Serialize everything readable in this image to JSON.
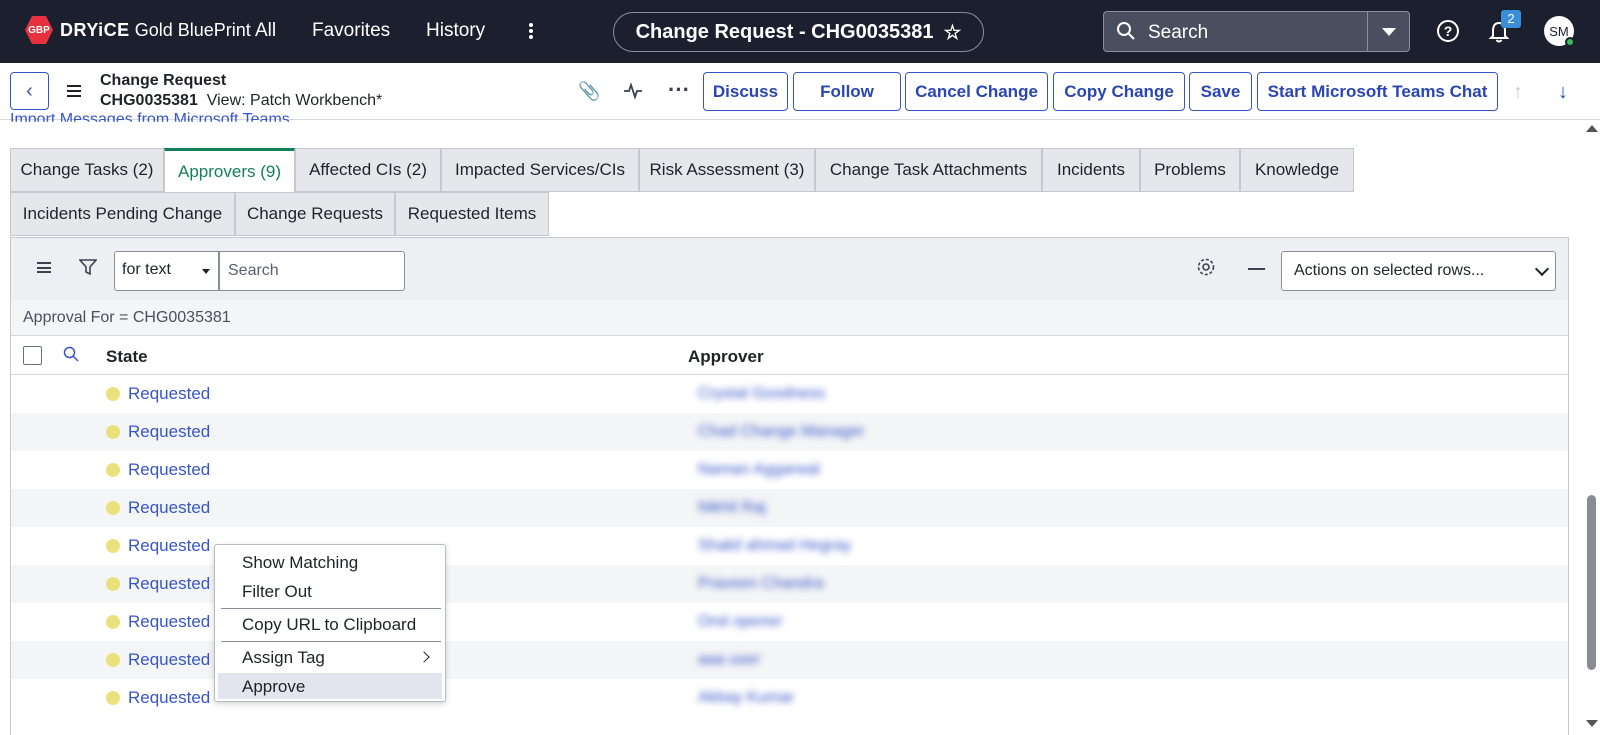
{
  "topnav": {
    "logo_text": "GBP",
    "brand_bold": "DRYiCE",
    "brand_rest": " Gold BluePrint",
    "links": [
      "All",
      "Favorites",
      "History"
    ],
    "record_title": "Change Request - CHG0035381",
    "search_placeholder": "Search",
    "notification_count": "2",
    "avatar_initials": "SM"
  },
  "form_header": {
    "title": "Change Request",
    "number": "CHG0035381",
    "view": "View: Patch Workbench*",
    "buttons": [
      "Discuss",
      "Follow",
      "Cancel Change",
      "Copy Change",
      "Save",
      "Start Microsoft Teams Chat"
    ]
  },
  "import_link": "Import Messages from Microsoft Teams",
  "tabs_row1": [
    "Change Tasks (2)",
    "Approvers (9)",
    "Affected CIs (2)",
    "Impacted Services/CIs",
    "Risk Assessment (3)",
    "Change Task Attachments",
    "Incidents",
    "Problems",
    "Knowledge"
  ],
  "tabs_row2": [
    "Incidents Pending Change",
    "Change Requests",
    "Requested Items"
  ],
  "active_tab": "Approvers (9)",
  "list": {
    "search_field": "for text",
    "search_placeholder": "Search",
    "actions_label": "Actions on selected rows...",
    "breadcrumb": "Approval For = CHG0035381",
    "columns": [
      "State",
      "Approver"
    ],
    "rows": [
      {
        "state": "Requested",
        "approver": "Crystal Goodness"
      },
      {
        "state": "Requested",
        "approver": "Chad Change Manager"
      },
      {
        "state": "Requested",
        "approver": "Naman Aggarwal"
      },
      {
        "state": "Requested",
        "approver": "Nikhil Raj"
      },
      {
        "state": "Requested",
        "approver": "Shakil ahmad Hegray"
      },
      {
        "state": "Requested",
        "approver": "Praveen Chandra"
      },
      {
        "state": "Requested",
        "approver": "Ond opener"
      },
      {
        "state": "Requested",
        "approver": "aaa user"
      },
      {
        "state": "Requested",
        "approver": "Akbay Kumar"
      }
    ]
  },
  "context_menu": {
    "items": [
      "Show Matching",
      "Filter Out",
      "Copy URL to Clipboard",
      "Assign Tag",
      "Approve"
    ]
  },
  "colors": {
    "nav_bg": "#1c1f2e",
    "accent_blue": "#3755c9",
    "active_tab_green": "#157f5a",
    "state_requested": "#ebe17c"
  }
}
